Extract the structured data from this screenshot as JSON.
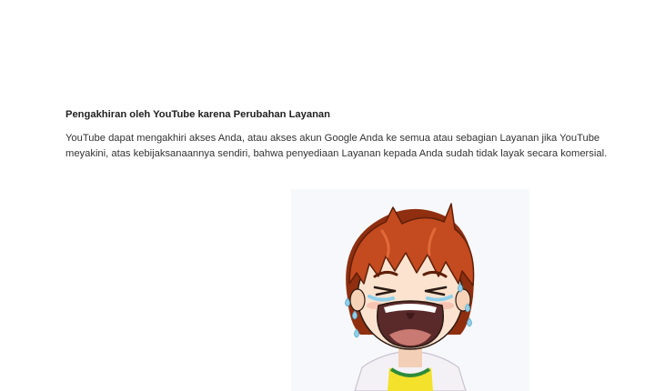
{
  "section": {
    "title": "Pengakhiran oleh YouTube karena Perubahan Layanan",
    "body_lines": [
      "YouTube dapat mengakhiri akses Anda, atau akses akun Google Anda ke semua atau sebagian Layanan jika YouTube",
      "meyakini, atas kebijaksanaannya sendiri, bahwa penyediaan Layanan kepada Anda sudah tidak layak secara komersial."
    ]
  },
  "illustration": {
    "icon": "crying-boy-illustration",
    "colors": {
      "hair": "#c44a1f",
      "hair_shadow": "#8f2f10",
      "skin": "#fbe3cf",
      "mouth": "#5a2a2a",
      "tongue": "#c97a72",
      "teeth": "#ffffff",
      "tears": "#8fd0ec",
      "shirt": "#f4f1f6",
      "collar": "#f3e12b",
      "collar_stripe": "#2e8b3a",
      "background": "#f7f8fb"
    }
  }
}
